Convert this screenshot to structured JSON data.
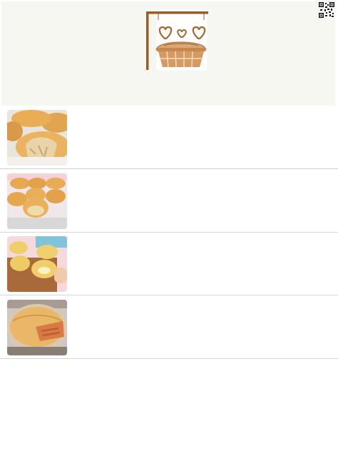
{
  "header": {
    "logo_icon": "pie-shop-sign-icon",
    "qr_icon": "qr-code-icon",
    "background": "#f7f7f1",
    "accent": "#a0612a"
  },
  "recipes": [
    {
      "image": "chicken-pie-photo"
    },
    {
      "image": "pies-on-tray-photo"
    },
    {
      "image": "cheese-pies-on-board-photo"
    },
    {
      "image": "large-meat-pie-photo"
    }
  ]
}
